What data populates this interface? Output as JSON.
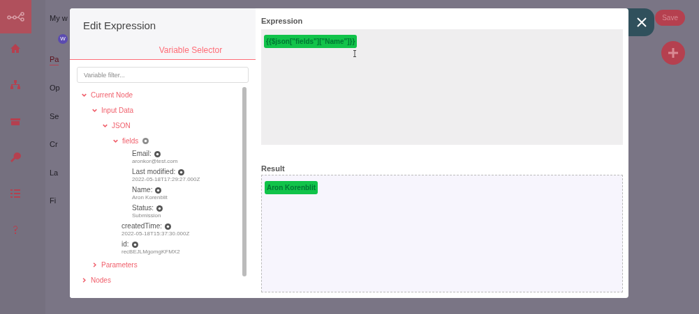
{
  "background": {
    "workflow_title": "My w",
    "badge": "W",
    "tab": "Pa",
    "fragments": [
      "Op",
      "Se",
      "Cr",
      "La",
      "Fi"
    ],
    "save_button": "Save"
  },
  "modal": {
    "title": "Edit Expression",
    "left_tab": {
      "label": "Variable Selector",
      "selected": true
    },
    "filter": {
      "placeholder": "Variable filter..."
    },
    "tree": [
      {
        "kind": "group",
        "label": "Current Node",
        "expanded": true,
        "children": [
          {
            "kind": "group",
            "label": "Input Data",
            "expanded": true,
            "children": [
              {
                "kind": "group",
                "label": "JSON",
                "expanded": true,
                "children": [
                  {
                    "kind": "group",
                    "label": "fields",
                    "expanded": true,
                    "info": true,
                    "children": [
                      {
                        "kind": "field",
                        "label": "Email:",
                        "value": "aronkor@test.com"
                      },
                      {
                        "kind": "field",
                        "label": "Last modified:",
                        "value": "2022-05-18T17:29:27.000Z"
                      },
                      {
                        "kind": "field",
                        "label": "Name:",
                        "value": "Aron Korenblit"
                      },
                      {
                        "kind": "field",
                        "label": "Status:",
                        "value": "Submission"
                      }
                    ]
                  },
                  {
                    "kind": "field",
                    "label": "createdTime:",
                    "value": "2022-05-18T15:37:30.000Z"
                  },
                  {
                    "kind": "field",
                    "label": "id:",
                    "value": "recBEJLMgomgKFMX2"
                  }
                ]
              }
            ]
          },
          {
            "kind": "group",
            "label": "Parameters",
            "expanded": false
          }
        ]
      },
      {
        "kind": "group",
        "label": "Nodes",
        "expanded": false
      }
    ],
    "expression": {
      "label": "Expression",
      "value": "{{$json[\"fields\"][\"Name\"]}}"
    },
    "result": {
      "label": "Result",
      "value": "Aron Korenblit"
    }
  }
}
